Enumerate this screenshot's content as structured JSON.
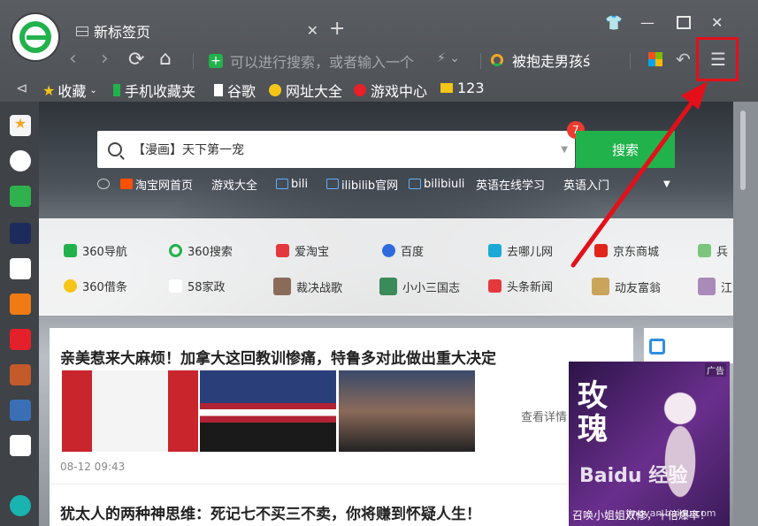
{
  "tab": {
    "title": "新标签页"
  },
  "address": {
    "placeholder": "可以进行搜索，或者输入一个"
  },
  "search_engine": {
    "label": "被抱走男孩ś"
  },
  "bookmarks": [
    "收藏",
    "手机收藏夹",
    "谷歌",
    "网址大全",
    "游戏中心",
    "123"
  ],
  "search": {
    "query": "【漫画】天下第一宠",
    "badge": "7",
    "button": "搜索"
  },
  "quick_links": [
    "淘宝网首页",
    "游戏大全",
    "bili",
    "ilibilib官网",
    "bilibiuli",
    "英语在线学习",
    "英语入门"
  ],
  "sites_row1": [
    "360导航",
    "360搜索",
    "爱淘宝",
    "百度",
    "去哪儿网",
    "京东商城",
    "兵"
  ],
  "sites_row2": [
    "360借条",
    "58家政",
    "裁决战歌",
    "小小三国志",
    "头条新闻",
    "动友富翁",
    "江"
  ],
  "news": {
    "headline": "亲美惹来大麻烦！加拿大这回教训惨痛，特鲁多对此做出重大决定",
    "more": "查看详情",
    "time": "08-12 09:43",
    "headline2": "犹太人的两种神思维：死记七不买三不卖，你将赚到怀疑人生！"
  },
  "ad": {
    "tag": "广告",
    "big": "玫瑰",
    "caption": "召唤小姐姐双修，十倍爆率！"
  },
  "watermark": {
    "main": "Baidu 经验",
    "sub": "jingyan.baidu.com"
  },
  "colors": {
    "accent_green": "#22b24c",
    "highlight_red": "#e3101a"
  }
}
